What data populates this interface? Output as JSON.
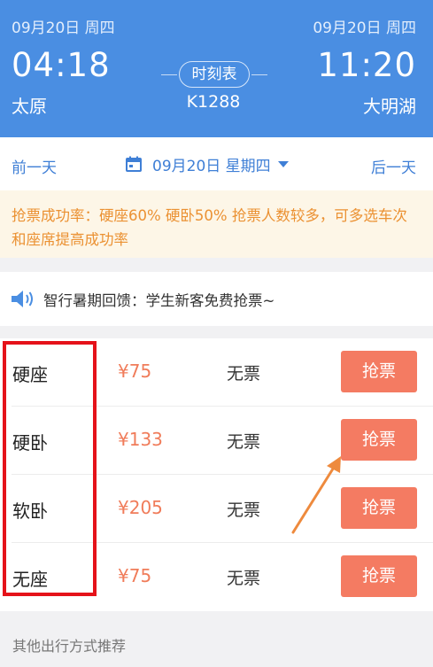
{
  "header": {
    "depart_date": "09月20日 周四",
    "arrive_date": "09月20日 周四",
    "depart_time": "04:18",
    "arrive_time": "11:20",
    "depart_station": "太原",
    "arrive_station": "大明湖",
    "timetable_label": "时刻表",
    "train_number": "K1288",
    "bg_color": "#4a8ee2"
  },
  "date_nav": {
    "prev_label": "前一天",
    "current_date": "09月20日 星期四",
    "next_label": "后一天",
    "icon": "calendar-icon"
  },
  "notice": {
    "text": "抢票成功率：硬座60% 硬卧50% 抢票人数较多，可多选车次和座席提高成功率",
    "color": "#eb9132"
  },
  "promo": {
    "icon": "speaker-icon",
    "text": "智行暑期回馈：学生新客免费抢票~"
  },
  "seats": [
    {
      "name": "硬座",
      "price": "¥75",
      "status": "无票",
      "action": "抢票"
    },
    {
      "name": "硬卧",
      "price": "¥133",
      "status": "无票",
      "action": "抢票"
    },
    {
      "name": "软卧",
      "price": "¥205",
      "status": "无票",
      "action": "抢票"
    },
    {
      "name": "无座",
      "price": "¥75",
      "status": "无票",
      "action": "抢票"
    }
  ],
  "footer": {
    "title": "其他出行方式推荐"
  },
  "colors": {
    "accent": "#f47b62",
    "highlight": "#e5121a",
    "arrow": "#ee8a3d"
  }
}
